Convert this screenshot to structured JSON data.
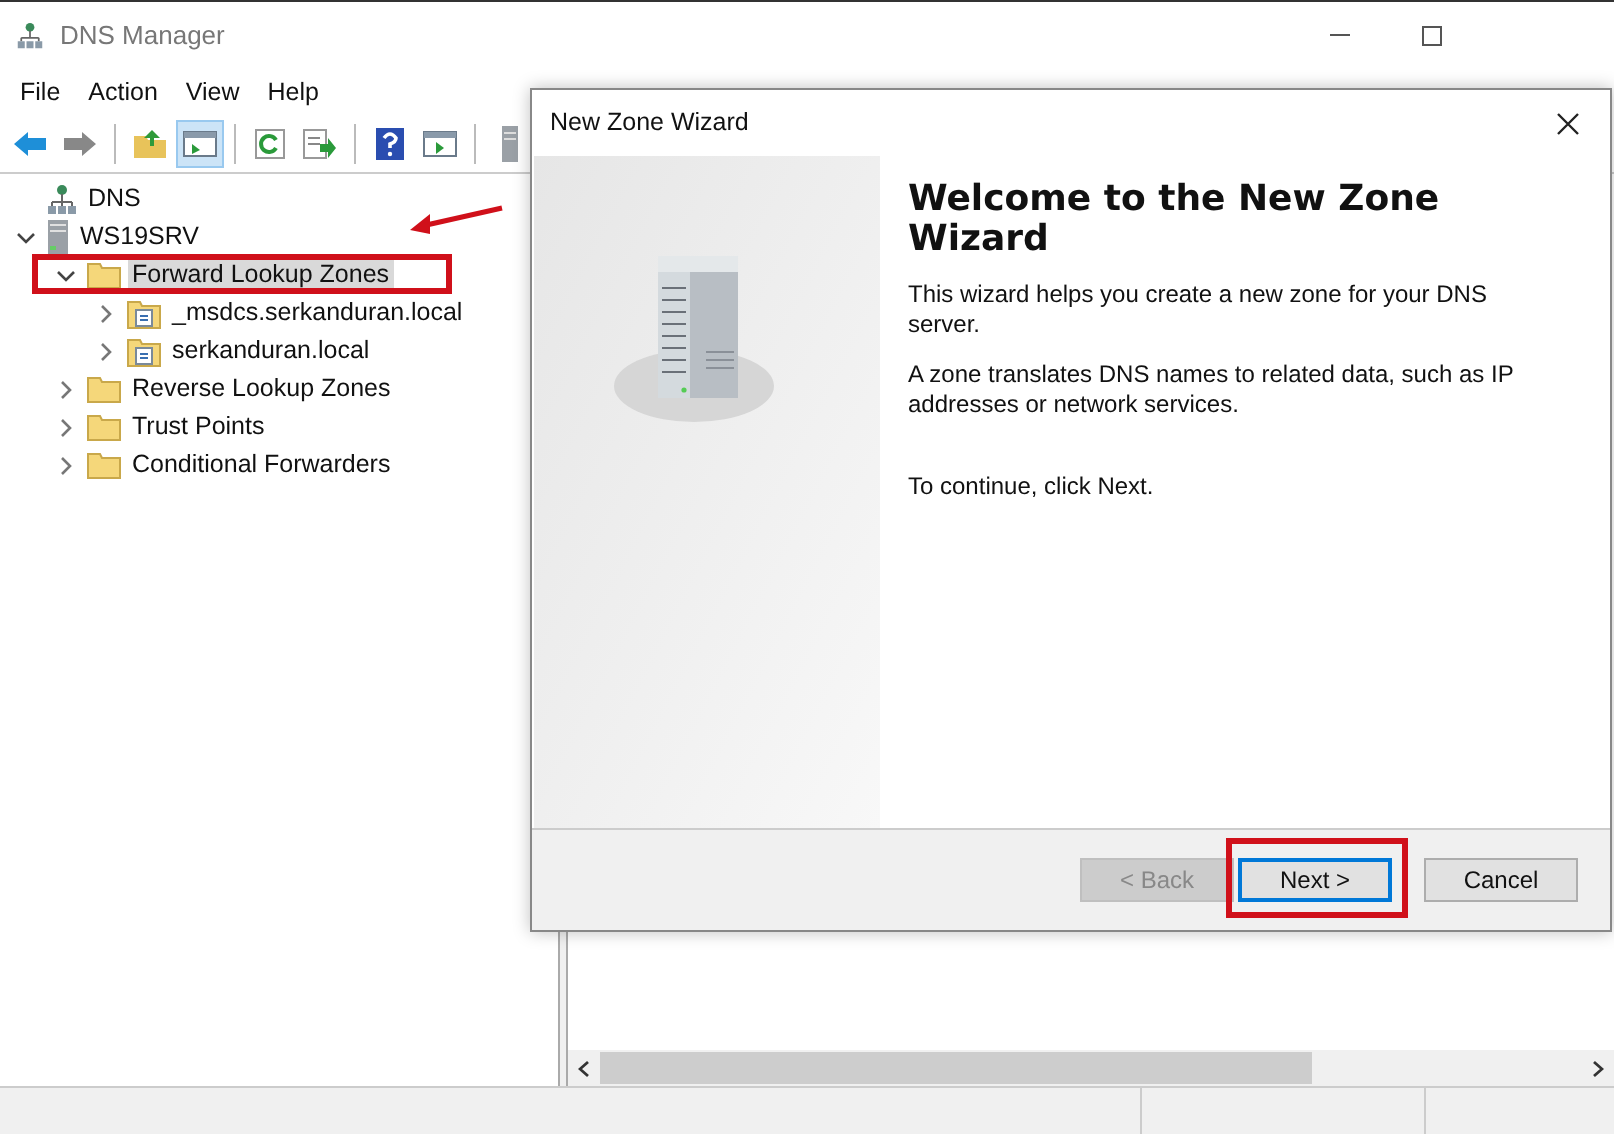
{
  "window": {
    "title": "DNS Manager"
  },
  "menu": [
    "File",
    "Action",
    "View",
    "Help"
  ],
  "toolbar": [
    {
      "kind": "back"
    },
    {
      "kind": "forward"
    },
    {
      "kind": "sep"
    },
    {
      "kind": "up"
    },
    {
      "kind": "tree",
      "pressed": true
    },
    {
      "kind": "sep"
    },
    {
      "kind": "refresh"
    },
    {
      "kind": "export"
    },
    {
      "kind": "sep"
    },
    {
      "kind": "help"
    },
    {
      "kind": "pane"
    },
    {
      "kind": "sep"
    },
    {
      "kind": "server"
    }
  ],
  "tree": [
    {
      "label": "DNS",
      "kind": "root",
      "selected": false,
      "children": [
        {
          "label": "WS19SRV",
          "kind": "server",
          "expanded": true,
          "selected": false,
          "children": [
            {
              "label": "Forward Lookup Zones",
              "kind": "folder",
              "expanded": true,
              "selected": true,
              "highlighted": true,
              "children": [
                {
                  "label": "_msdcs.serkanduran.local",
                  "kind": "zone",
                  "expanded": false,
                  "selected": false
                },
                {
                  "label": "serkanduran.local",
                  "kind": "zone",
                  "expanded": false,
                  "selected": false
                }
              ]
            },
            {
              "label": "Reverse Lookup Zones",
              "kind": "folder",
              "expanded": false,
              "selected": false
            },
            {
              "label": "Trust Points",
              "kind": "folder",
              "expanded": false,
              "selected": false
            },
            {
              "label": "Conditional Forwarders",
              "kind": "folder",
              "expanded": false,
              "selected": false
            }
          ]
        }
      ]
    }
  ],
  "dialog": {
    "title": "New Zone Wizard",
    "heading": "Welcome to the New Zone Wizard",
    "paragraphs": [
      "This wizard helps you create a new zone for your DNS server.",
      "A zone translates DNS names to related data, such as IP addresses or network services."
    ],
    "footer_note": "To continue, click Next.",
    "buttons": [
      {
        "label": "< Back",
        "disabled": true
      },
      {
        "label": "Next >",
        "disabled": false,
        "default": true,
        "highlighted": true
      },
      {
        "label": "Cancel",
        "disabled": false
      }
    ]
  }
}
